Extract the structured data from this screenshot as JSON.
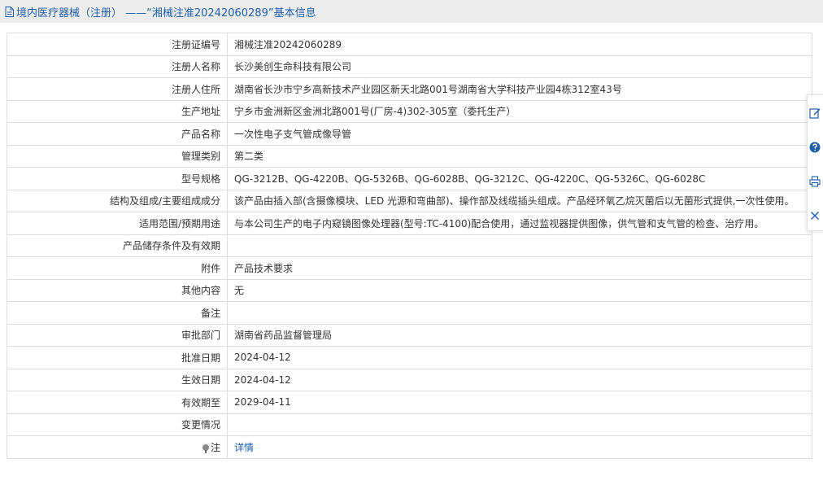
{
  "header": {
    "title": "境内医疗器械（注册） ——“湘械注准20242060289”基本信息"
  },
  "rows": [
    {
      "label": "注册证编号",
      "value": "湘械注准20242060289"
    },
    {
      "label": "注册人名称",
      "value": "长沙美创生命科技有限公司"
    },
    {
      "label": "注册人住所",
      "value": "湖南省长沙市宁乡高新技术产业园区新天北路001号湖南省大学科技产业园4栋312室43号"
    },
    {
      "label": "生产地址",
      "value": "宁乡市金洲新区金洲北路001号(厂房-4)302-305室（委托生产）"
    },
    {
      "label": "产品名称",
      "value": "一次性电子支气管成像导管"
    },
    {
      "label": "管理类别",
      "value": "第二类"
    },
    {
      "label": "型号规格",
      "value": "QG-3212B、QG-4220B、QG-5326B、QG-6028B、QG-3212C、QG-4220C、QG-5326C、QG-6028C"
    },
    {
      "label": "结构及组成/主要组成成分",
      "value": "该产品由插入部(含摄像模块、LED 光源和弯曲部)、操作部及线缆插头组成。产品经环氧乙烷灭菌后以无菌形式提供,一次性使用。"
    },
    {
      "label": "适用范围/预期用途",
      "value": "与本公司生产的电子内窥镜图像处理器(型号:TC-4100)配合使用，通过监视器提供图像，供气管和支气管的检查、治疗用。"
    },
    {
      "label": "产品储存条件及有效期",
      "value": ""
    },
    {
      "label": "附件",
      "value": "产品技术要求"
    },
    {
      "label": "其他内容",
      "value": "无"
    },
    {
      "label": "备注",
      "value": ""
    },
    {
      "label": "审批部门",
      "value": "湖南省药品监督管理局"
    },
    {
      "label": "批准日期",
      "value": "2024-04-12"
    },
    {
      "label": "生效日期",
      "value": "2024-04-12"
    },
    {
      "label": "有效期至",
      "value": "2029-04-11"
    },
    {
      "label": "变更情况",
      "value": ""
    }
  ],
  "note_row": {
    "label": "注",
    "link": "详情"
  },
  "icons": {
    "header": "document-icon",
    "note": "pin-icon",
    "toolbar": [
      "edit-icon",
      "help-icon",
      "print-icon",
      "close-icon"
    ]
  },
  "colors": {
    "accent": "#1f5fa8",
    "header_bg": "#ececec"
  }
}
